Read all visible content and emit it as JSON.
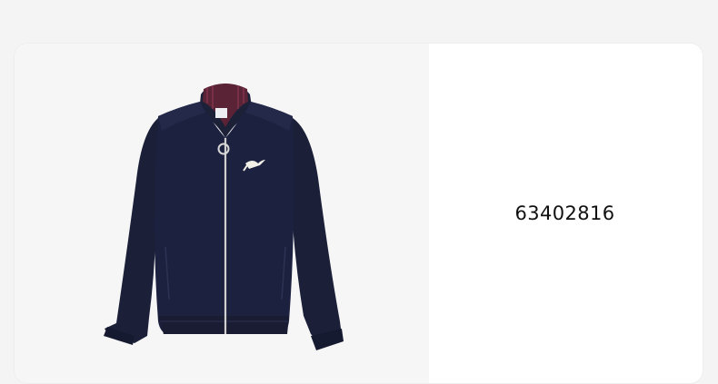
{
  "product": {
    "id": "63402816",
    "image_subject": "jacket-icon",
    "colors": {
      "page_bg": "#f4f4f4",
      "card_bg": "#ffffff",
      "image_bg": "#f6f6f6",
      "jacket": "#1b1f38",
      "collar_accent": "#6b2a3e",
      "zipper": "#cfcfcf",
      "logo": "#f2efe6",
      "text": "#111111"
    }
  }
}
